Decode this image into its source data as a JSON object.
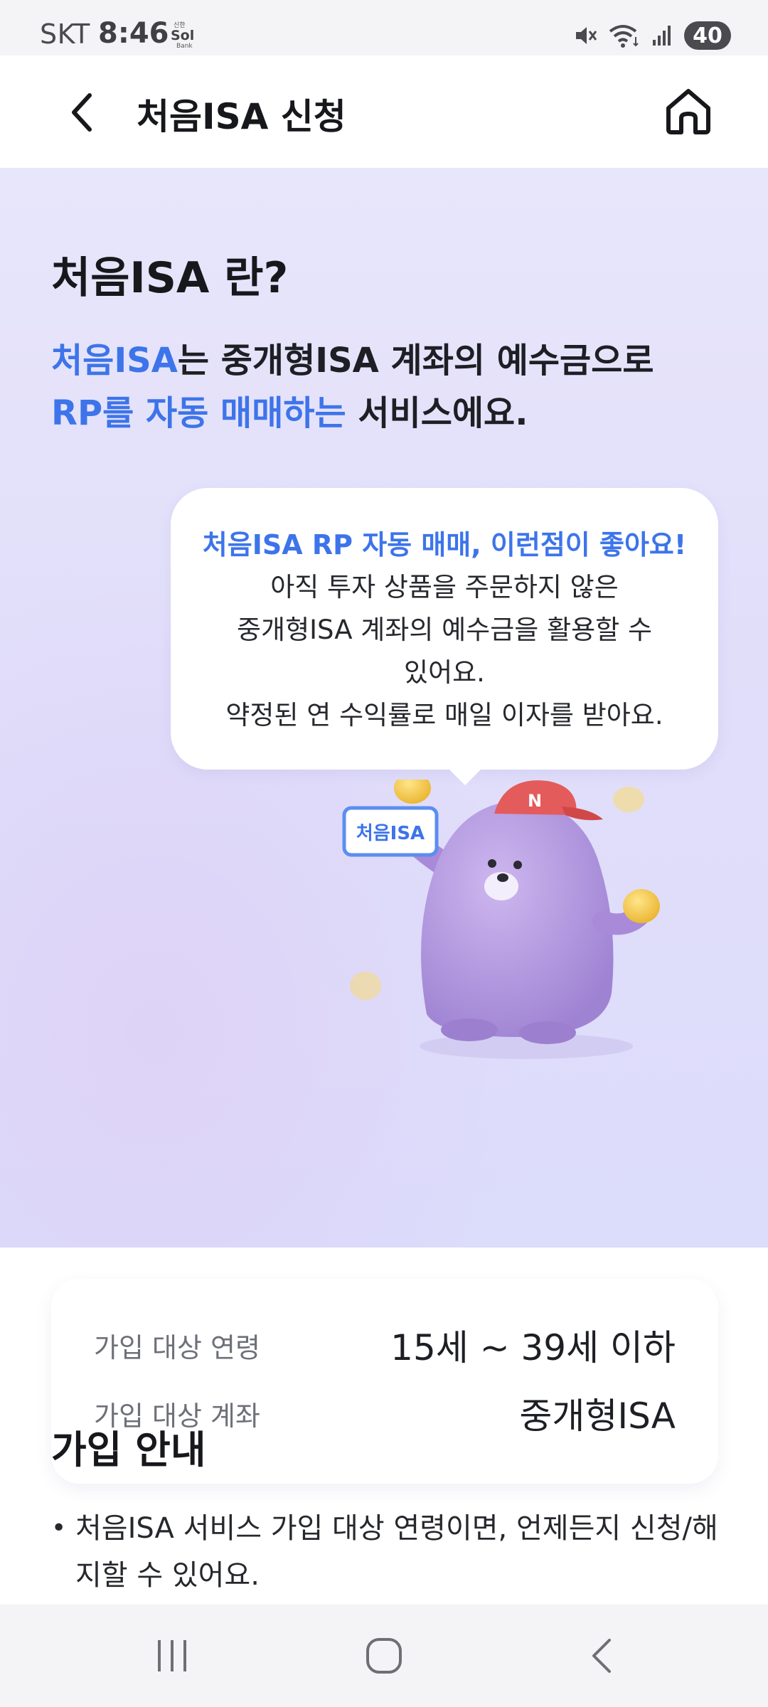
{
  "status_bar": {
    "carrier": "SKT",
    "time": "8:46",
    "app_tiny": "신한",
    "app_name": "Sol",
    "app_sub": "Bank",
    "battery": "40"
  },
  "header": {
    "title": "처음ISA 신청"
  },
  "intro": {
    "title": "처음ISA 란?",
    "desc_hl1": "처음ISA",
    "desc_part1": "는 중개형ISA 계좌의 예수금으로",
    "desc_hl2": "RP를 자동 매매하는",
    "desc_part2": " 서비스에요."
  },
  "bubble": {
    "heading": "처음ISA RP 자동 매매, 이런점이 좋아요!",
    "lines": [
      "아직 투자 상품을 주문하지 않은",
      "중개형ISA 계좌의 예수금을 활용할 수",
      "있어요.",
      "약정된 연 수익률로 매일 이자를 받아요."
    ]
  },
  "character": {
    "sign_text": "처음ISA"
  },
  "info": {
    "rows": [
      {
        "label": "가입 대상 연령",
        "value": "15세 ~ 39세 이하"
      },
      {
        "label": "가입 대상 계좌",
        "value": "중개형ISA"
      }
    ]
  },
  "guide": {
    "title": "가입 안내",
    "items": [
      "처음ISA 서비스 가입 대상 연령이면, 언제든지 신청/해지할 수 있어요."
    ]
  },
  "colors": {
    "accent": "#3d74ea",
    "hero_bg": "#e4e1fa",
    "character": "#b39ddb",
    "cap": "#e35b5b",
    "coin": "#f3c84b"
  },
  "icons": {
    "back": "chevron-left-icon",
    "home": "home-icon",
    "nav_recent": "recent-apps-icon",
    "nav_home": "nav-home-icon",
    "nav_back": "nav-back-icon"
  }
}
